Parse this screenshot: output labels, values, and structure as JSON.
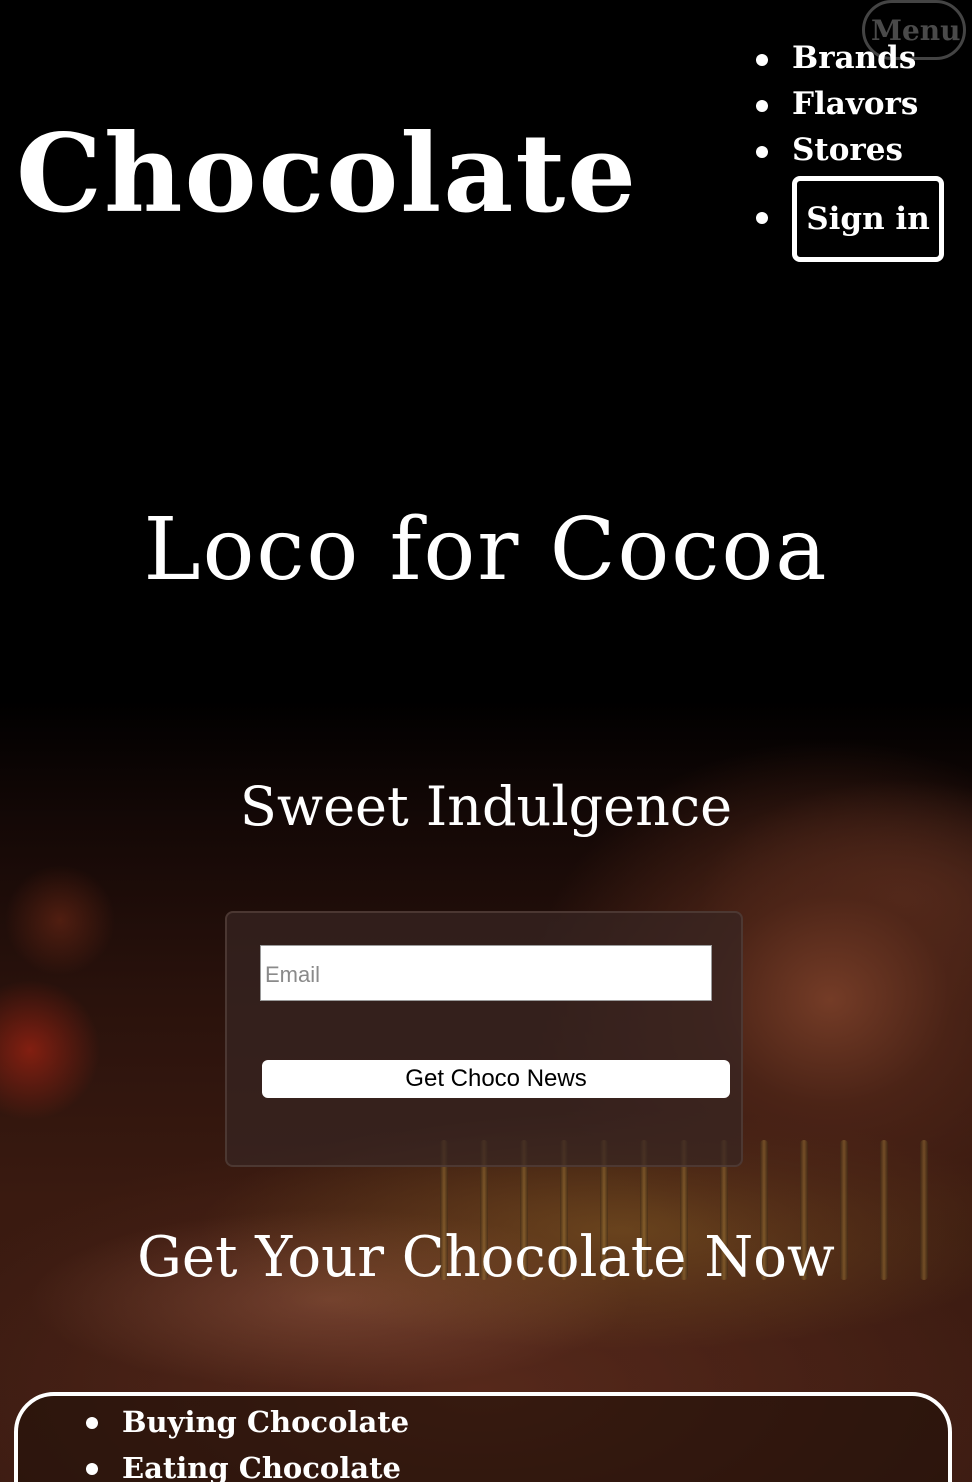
{
  "header": {
    "menu_label": "Menu",
    "logo_text": "Chocolate",
    "nav": [
      {
        "label": "Brands"
      },
      {
        "label": "Flavors"
      },
      {
        "label": "Stores"
      }
    ],
    "signin_label": "Sign in"
  },
  "hero": {
    "title": "Loco for Cocoa",
    "subtitle": "Sweet Indulgence"
  },
  "newsletter": {
    "email_placeholder": "Email",
    "email_value": "",
    "submit_label": "Get Choco News"
  },
  "shop": {
    "title": "Get Your Chocolate Now",
    "links": [
      {
        "label": "Buying Chocolate"
      },
      {
        "label": "Eating Chocolate"
      }
    ]
  }
}
